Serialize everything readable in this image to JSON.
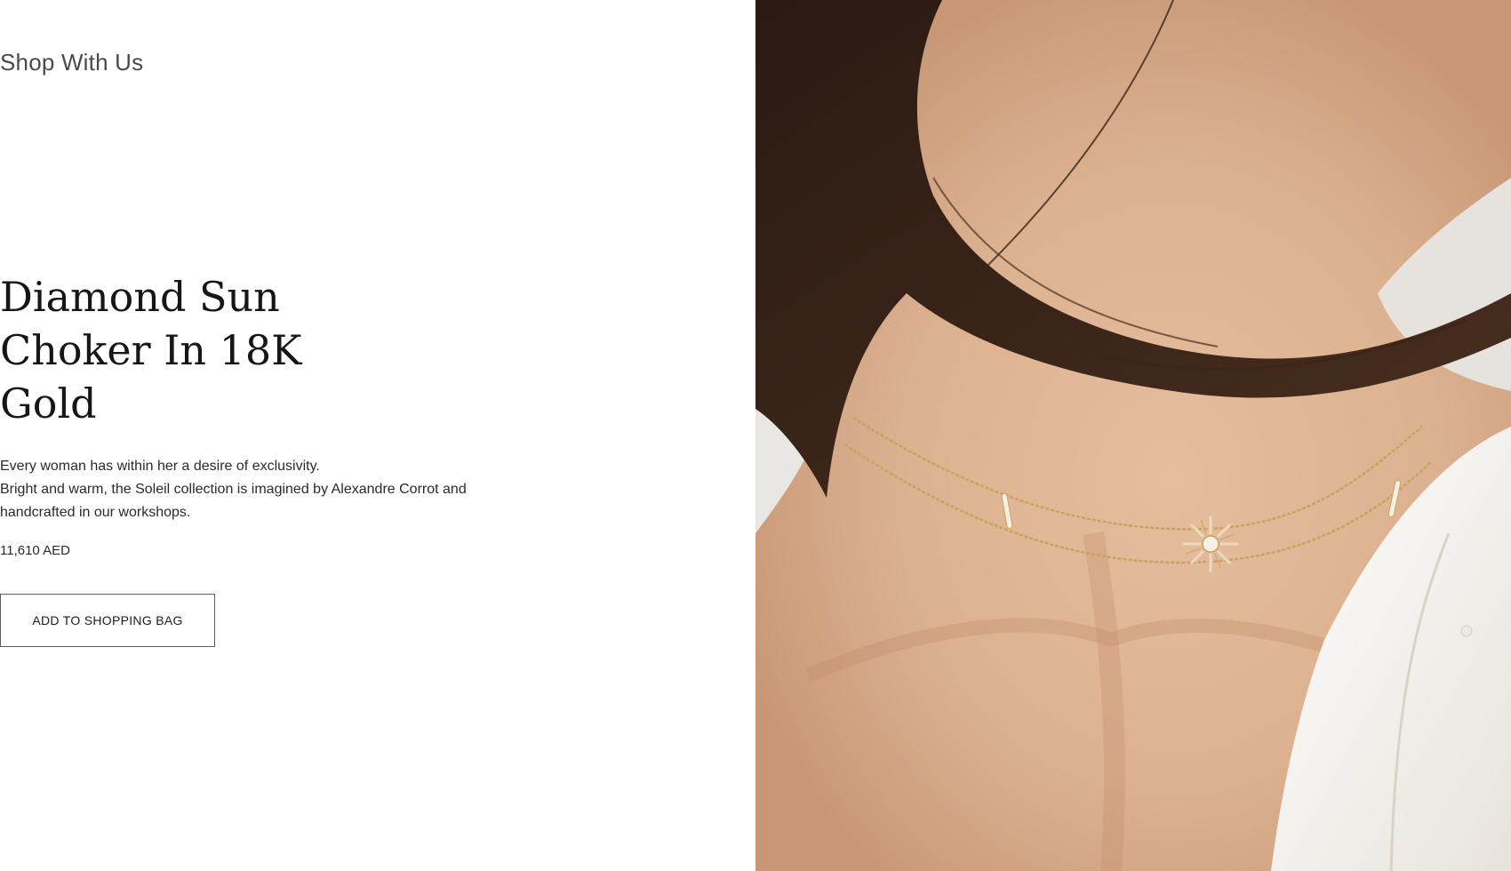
{
  "header": {
    "section_label": "Shop With Us"
  },
  "product": {
    "title_line1": "Diamond Sun",
    "title_line2": "Choker In 18K Gold",
    "description_lines": [
      "Every woman has within her a desire of exclusivity.",
      "Bright and warm, the Soleil collection is imagined by Alexandre Corrot and",
      "handcrafted in our workshops."
    ],
    "price": "11,610 AED",
    "add_to_bag_label": "ADD TO SHOPPING BAG"
  },
  "hero_image": {
    "icon": "product-model-photo",
    "colors": {
      "skin": "#deb594",
      "hair": "#3a2418",
      "chain_gold": "#c9a25e",
      "shirt": "#f4f1ec",
      "backdrop": "#e9e7e4"
    }
  }
}
